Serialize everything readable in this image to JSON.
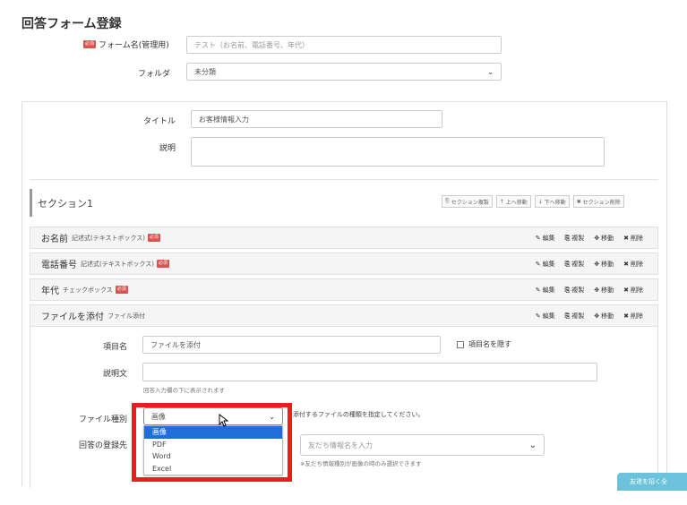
{
  "page": {
    "title": "回答フォーム登録"
  },
  "form": {
    "name_label": "フォーム名(管理用)",
    "required_badge": "必須",
    "name_placeholder": "テスト（お名前、電話番号、年代）",
    "folder_label": "フォルダ",
    "folder_value": "未分類"
  },
  "content": {
    "title_label": "タイトル",
    "title_value": "お客様情報入力",
    "desc_label": "説明",
    "desc_value": ""
  },
  "section": {
    "name": "セクション1",
    "buttons": {
      "copy": "セクション複製",
      "up": "上へ移動",
      "down": "下へ移動",
      "delete": "セクション削除"
    }
  },
  "actions": {
    "edit": "編集",
    "copy": "複製",
    "move": "移動",
    "delete": "削除"
  },
  "items": [
    {
      "name": "お名前",
      "type": "記述式(テキストボックス)",
      "required": "必須"
    },
    {
      "name": "電話番号",
      "type": "記述式(テキストボックス)",
      "required": "必須"
    },
    {
      "name": "年代",
      "type": "チェックボックス",
      "required": "必須"
    },
    {
      "name": "ファイルを添付",
      "type": "ファイル添付",
      "required": ""
    }
  ],
  "editor": {
    "item_name_label": "項目名",
    "item_name_value": "ファイルを添付",
    "hide_label": "項目名を隠す",
    "desc_label": "説明文",
    "desc_value": "",
    "desc_help": "回答入力欄の下に表示されます",
    "file_type_label": "ファイル種別",
    "file_type_value": "画像",
    "file_type_help": "※添付するファイルの種類を指定してください。",
    "file_type_options": [
      "画像",
      "PDF",
      "Word",
      "Excel"
    ],
    "dest_label": "回答の登録先",
    "dest_placeholder": "友だち情報名を入力",
    "dest_help": "※友だち情報種別が画像の時のみ選択できます"
  },
  "floating": {
    "label": "友達を招く全"
  }
}
